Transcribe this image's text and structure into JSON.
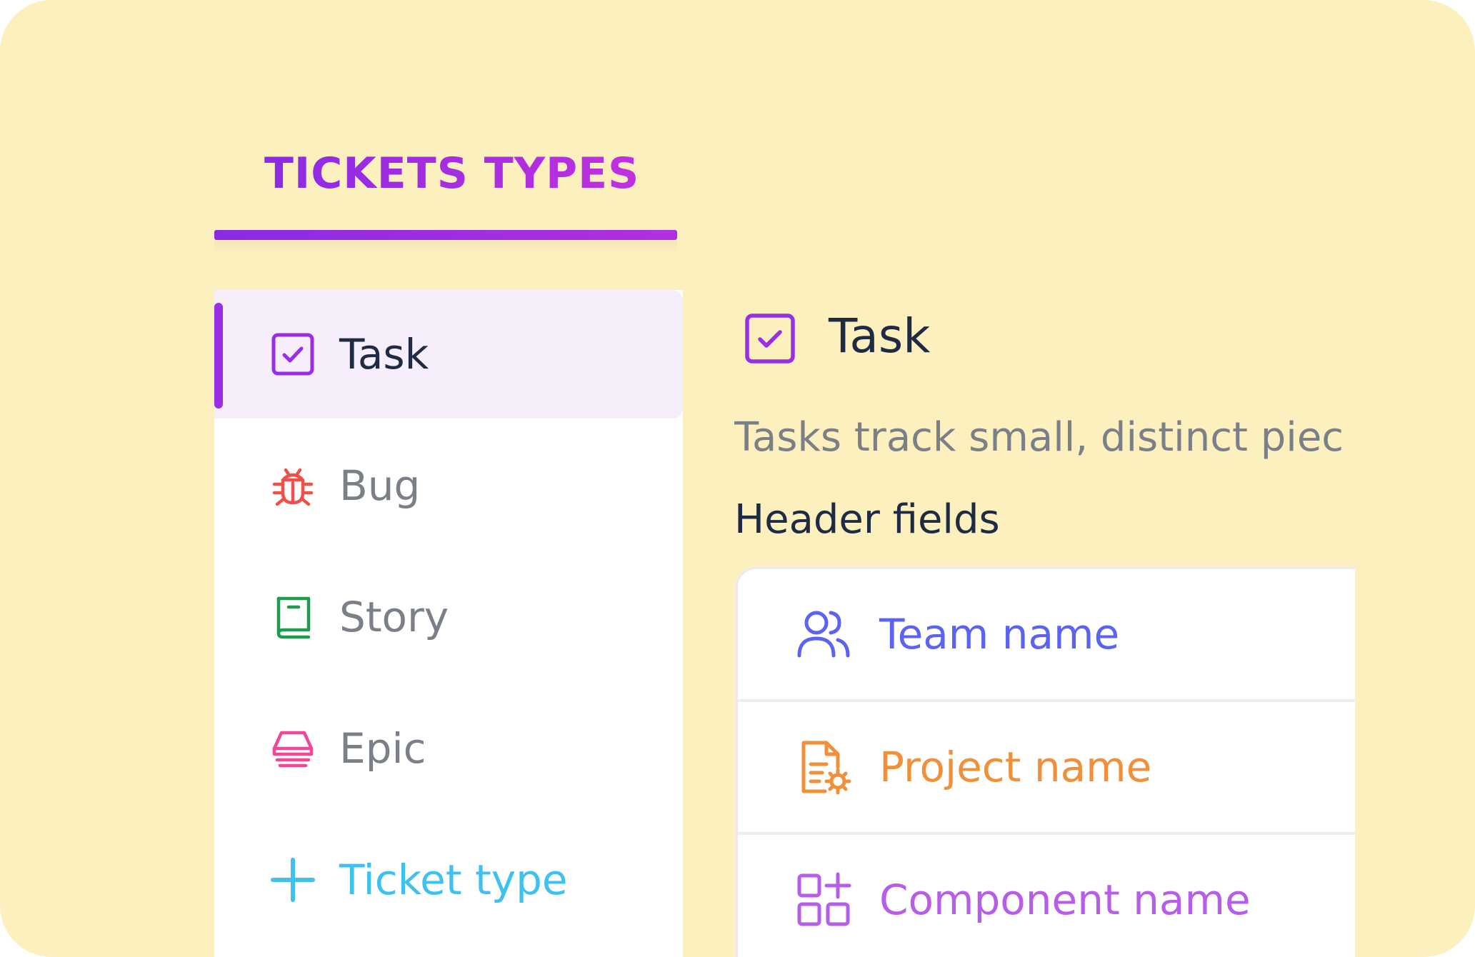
{
  "section": {
    "title": "TICKETS TYPES"
  },
  "ticket_types": {
    "items": [
      {
        "label": "Task",
        "icon": "task-checkbox-icon",
        "color": "#9a2ee4",
        "active": true
      },
      {
        "label": "Bug",
        "icon": "bug-icon",
        "color": "#f0504a",
        "active": false
      },
      {
        "label": "Story",
        "icon": "book-icon",
        "color": "#1f9a4e",
        "active": false
      },
      {
        "label": "Epic",
        "icon": "epic-stack-icon",
        "color": "#f0479a",
        "active": false
      }
    ],
    "add_label": "Ticket type",
    "add_icon": "plus-icon",
    "add_color": "#3fc1f0"
  },
  "detail": {
    "title": "Task",
    "description": "Tasks track small, distinct piec",
    "header_fields_label": "Header fields",
    "fields": [
      {
        "label": "Team name",
        "icon": "team-icon",
        "color": "#5b63f0"
      },
      {
        "label": "Project name",
        "icon": "project-document-icon",
        "color": "#f0903a"
      },
      {
        "label": "Component name",
        "icon": "component-grid-icon",
        "color": "#b75ee8"
      }
    ]
  }
}
